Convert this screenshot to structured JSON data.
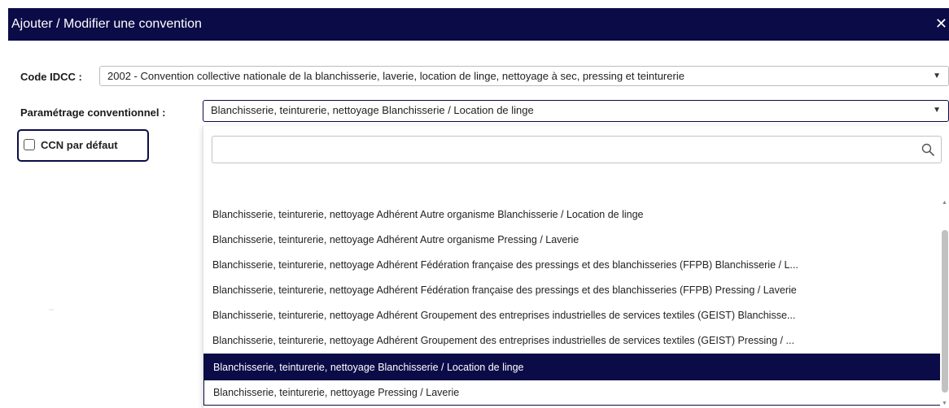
{
  "dialog": {
    "title": "Ajouter / Modifier une convention",
    "close_symbol": "✕"
  },
  "fields": {
    "idcc": {
      "label": "Code IDCC :",
      "value": "2002 - Convention collective nationale de la blanchisserie, laverie, location de linge, nettoyage à sec, pressing et teinturerie",
      "caret": "▼"
    },
    "parametrage": {
      "label": "Paramétrage conventionnel :",
      "value": "Blanchisserie, teinturerie, nettoyage Blanchisserie / Location de linge",
      "caret": "▼"
    },
    "ccn_default": {
      "label": "CCN par défaut",
      "checked": false
    }
  },
  "dropdown": {
    "search_value": "",
    "search_icon": "search-icon",
    "options": [
      "Blanchisserie, teinturerie, nettoyage Adhérent Autre organisme Blanchisserie / Location de linge",
      "Blanchisserie, teinturerie, nettoyage Adhérent Autre organisme Pressing / Laverie",
      "Blanchisserie, teinturerie, nettoyage Adhérent Fédération française des pressings et des blanchisseries (FFPB) Blanchisserie / L...",
      "Blanchisserie, teinturerie, nettoyage Adhérent Fédération française des pressings et des blanchisseries (FFPB) Pressing / Laverie",
      "Blanchisserie, teinturerie, nettoyage Adhérent Groupement des entreprises industrielles de services textiles (GEIST) Blanchisse...",
      "Blanchisserie, teinturerie, nettoyage Adhérent Groupement des entreprises industrielles de services textiles (GEIST) Pressing / ...",
      "Blanchisserie, teinturerie, nettoyage Blanchisserie / Location de linge",
      "Blanchisserie, teinturerie, nettoyage Pressing / Laverie"
    ],
    "selected_index": 6
  },
  "colors": {
    "accent": "#0b0b48",
    "border": "#bdbdbd"
  }
}
